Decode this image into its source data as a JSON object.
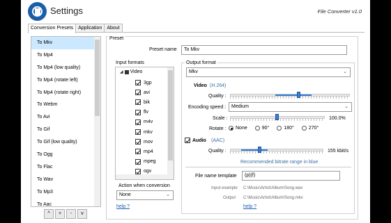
{
  "app": {
    "title": "Settings",
    "version": "File Converter v1.0"
  },
  "tabs": [
    "Conversion Presets",
    "Application",
    "About"
  ],
  "presets": {
    "items": [
      "To Mkv",
      "To Mp4",
      "To Mp4 (low quality)",
      "To Mp4 (rotate left)",
      "To Mp4 (rotate right)",
      "To Webm",
      "To Avi",
      "To Gif",
      "To Gif (low quality)",
      "To Ogg",
      "To Flac",
      "To Wav",
      "To Mp3",
      "To Aac"
    ],
    "selected_index": 0,
    "buttons": [
      "^",
      "+",
      "-",
      "v"
    ]
  },
  "preset": {
    "group_label": "Preset",
    "name_label": "Preset name",
    "name_value": "To Mkv"
  },
  "input_formats": {
    "label": "Input formats",
    "root": "Video",
    "formats": [
      "3gp",
      "avi",
      "bik",
      "flv",
      "m4v",
      "mkv",
      "mov",
      "mp4",
      "mpeg",
      "ogv"
    ]
  },
  "action": {
    "label": "Action when conversion",
    "value": "None",
    "help": "help ?"
  },
  "output": {
    "label": "Output format",
    "format": "Mkv",
    "video_label": "Video",
    "video_codec": "(H.264)",
    "quality_label": "Quality :",
    "video_quality_fraction": 0.36,
    "encoding_speed_label": "Encoding speed :",
    "encoding_speed_value": "Medium",
    "scale_label": "Scale :",
    "scale_value": "100.0%",
    "scale_fraction": 0.4,
    "rotate_label": "Rotate :",
    "rotate_options": [
      "None",
      "90°",
      "180°",
      "270°"
    ],
    "rotate_selected": 0,
    "audio_label": "Audio",
    "audio_codec": "(AAC)",
    "audio_checked": true,
    "audio_quality_label": "Quality :",
    "audio_quality_value": "155 kbit/s",
    "audio_quality_fraction": 0.3,
    "recommended_text": "Recommended bitrate range in blue",
    "file_name_template_label": "File name template",
    "file_name_template_value": "(p)(f)",
    "input_example_label": "Input example",
    "input_example_value": "C:\\Music\\Artist\\Album\\Song.wav",
    "output_label": "Output",
    "output_value": "C:\\Music\\Artist\\Album\\Song.mkv",
    "help": "help ?"
  },
  "colors": {
    "accent": "#2f7ed8",
    "selected": "#cce8ff",
    "logo": "#1b5fa8"
  }
}
